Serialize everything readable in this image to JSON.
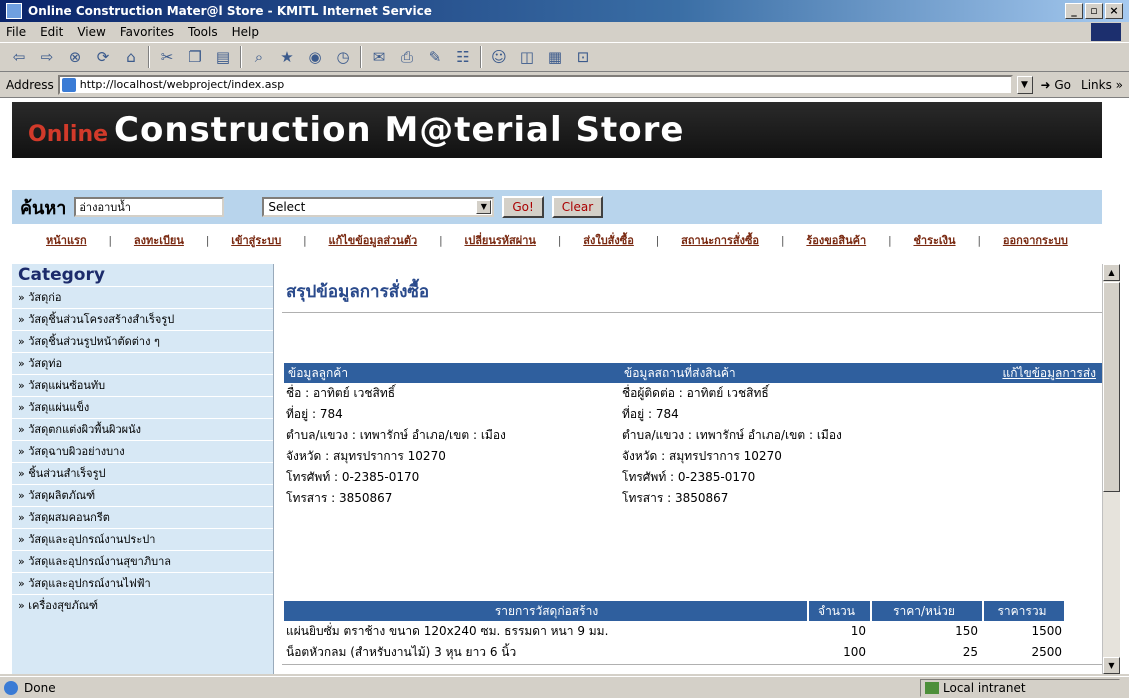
{
  "window": {
    "title": "Online Construction Mater@l Store - KMITL Internet Service",
    "min": "_",
    "max": "▫",
    "close": "×"
  },
  "menu": [
    "File",
    "Edit",
    "View",
    "Favorites",
    "Tools",
    "Help"
  ],
  "address": {
    "label": "Address",
    "url": "http://localhost/webproject/index.asp",
    "go": "Go",
    "links": "Links »"
  },
  "banner": {
    "online": "Online",
    "brand": "Construction M@terial Store"
  },
  "search": {
    "label": "ค้นหา",
    "value": "อ่างอาบน้ำ",
    "select": "Select",
    "go": "Go!",
    "clear": "Clear"
  },
  "nav": [
    "หน้าแรก",
    "ลงทะเบียน",
    "เข้าสู่ระบบ",
    "แก้ไขข้อมูลส่วนตัว",
    "เปลี่ยนรหัสผ่าน",
    "ส่งใบสั่งซื้อ",
    "สถานะการสั่งซื้อ",
    "ร้องขอสินค้า",
    "ชำระเงิน",
    "ออกจากระบบ"
  ],
  "sidebar": {
    "title": "Category",
    "items": [
      "» วัสดุก่อ",
      "» วัสดุชิ้นส่วนโครงสร้างสำเร็จรูป",
      "» วัสดุชิ้นส่วนรูปหน้าตัดต่าง ๆ",
      "» วัสดุท่อ",
      "» วัสดุแผ่นซ้อนทับ",
      "» วัสดุแผ่นแข็ง",
      "» วัสดุตกแต่งผิวพื้นผิวผนัง",
      "» วัสดุฉาบผิวอย่างบาง",
      "» ชิ้นส่วนสำเร็จรูป",
      "» วัสดุผลิตภัณฑ์",
      "» วัสดุผสมคอนกรีต",
      "» วัสดุและอุปกรณ์งานประปา",
      "» วัสดุและอุปกรณ์งานสุขาภิบาล",
      "» วัสดุและอุปกรณ์งานไฟฟ้า",
      "» เครื่องสุขภัณฑ์"
    ]
  },
  "content": {
    "heading": "สรุปข้อมูลการสั่งซื้อ",
    "customer": {
      "header": "ข้อมูลลูกค้า",
      "lines": [
        "ชื่อ : อาทิตย์ เวชสิทธิ์",
        "ที่อยู่ : 784",
        "ตำบล/แขวง : เทพารักษ์ อำเภอ/เขต : เมือง",
        "จังหวัด : สมุทรปราการ 10270",
        "โทรศัพท์ : 0-2385-0170",
        "โทรสาร : 3850867"
      ]
    },
    "shipping": {
      "header": "ข้อมูลสถานที่ส่งสินค้า",
      "edit": "แก้ไขข้อมูลการส่ง",
      "lines": [
        "ชื่อผู้ติดต่อ : อาทิตย์ เวชสิทธิ์",
        "ที่อยู่ : 784",
        "ตำบล/แขวง : เทพารักษ์ อำเภอ/เขต : เมือง",
        "จังหวัด : สมุทรปราการ 10270",
        "โทรศัพท์ : 0-2385-0170",
        "โทรสาร : 3850867"
      ]
    },
    "order": {
      "headers": [
        "รายการวัสดุก่อสร้าง",
        "จำนวน",
        "ราคา/หน่วย",
        "ราคารวม"
      ],
      "rows": [
        [
          "แผ่นยิบซั่ม ตราช้าง ขนาด 120x240 ซม. ธรรมดา หนา 9 มม.",
          "10",
          "150",
          "1500"
        ],
        [
          "น็อตหัวกลม (สำหรับงานไม้) 3 หุน ยาว 6 นิ้ว",
          "100",
          "25",
          "2500"
        ]
      ]
    }
  },
  "status": {
    "text": "Done",
    "zone": "Local intranet"
  }
}
